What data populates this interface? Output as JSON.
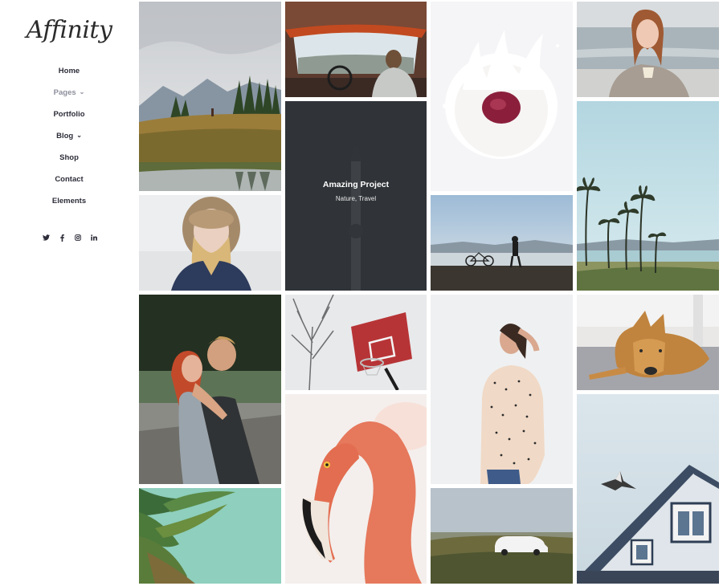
{
  "brand": {
    "logo": "Affinity"
  },
  "nav": {
    "items": [
      {
        "label": "Home",
        "has_dropdown": false
      },
      {
        "label": "Pages",
        "has_dropdown": true,
        "active": true
      },
      {
        "label": "Portfolio",
        "has_dropdown": false
      },
      {
        "label": "Blog",
        "has_dropdown": true
      },
      {
        "label": "Shop",
        "has_dropdown": false
      },
      {
        "label": "Contact",
        "has_dropdown": false
      },
      {
        "label": "Elements",
        "has_dropdown": false
      }
    ],
    "dropdown_icon": "chevron-down-icon"
  },
  "social": {
    "twitter": "twitter-icon",
    "facebook": "facebook-icon",
    "instagram": "instagram-icon",
    "linkedin": "linkedin-icon"
  },
  "portfolio": {
    "hovered_item": {
      "title": "Amazing Project",
      "categories": "Nature, Travel"
    },
    "items": [
      "mountain-lake-photo",
      "van-interior-photo",
      "milk-raspberry-photo",
      "redhead-sea-photo",
      "rocket-project-photo",
      "palm-trees-beach-photo",
      "fur-hood-woman-photo",
      "bicycle-pier-photo",
      "couple-kissing-photo",
      "basketball-hoop-photo",
      "woman-dotted-shirt-photo",
      "dog-lying-photo",
      "flamingo-photo",
      "palm-leaves-photo",
      "car-field-photo",
      "house-bird-photo"
    ]
  },
  "colors": {
    "nav_text": "#2d2d3a",
    "nav_active": "#8d8f9c",
    "overlay": "#32363a"
  }
}
